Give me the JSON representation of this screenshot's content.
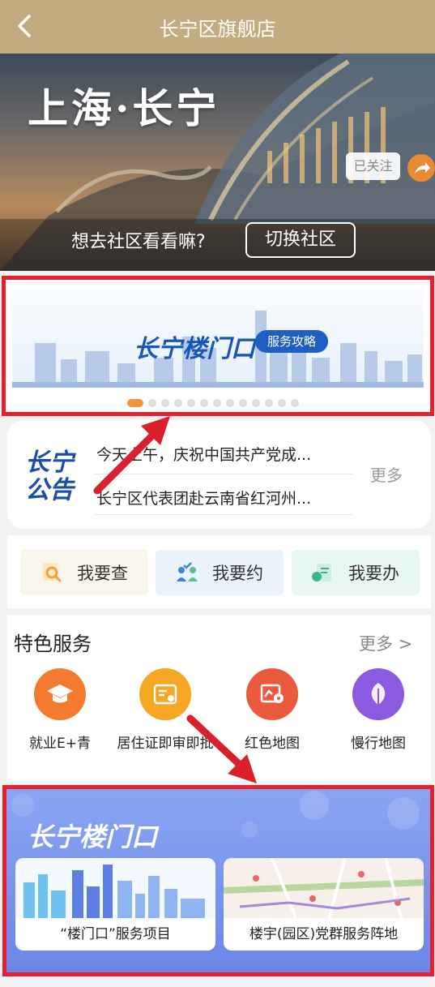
{
  "topbar": {
    "title": "长宁区旗舰店"
  },
  "hero": {
    "city_title": "上海·长宁",
    "followed_label": "已关注",
    "question": "想去社区看看嘛?",
    "switch_label": "切换社区"
  },
  "banner": {
    "logo_text": "长宁楼门口",
    "tag": "服务攻略",
    "page_count": 13,
    "active_page": 1
  },
  "notice": {
    "badge": "长宁公告",
    "items": [
      "今天上午，庆祝中国共产党成...",
      "长宁区代表团赴云南省红河州..."
    ],
    "more": "更多"
  },
  "quick_actions": [
    {
      "label": "我要查",
      "icon": "search-doc-icon",
      "bg": "#fbf6ec",
      "accent": "#f3a23a"
    },
    {
      "label": "我要约",
      "icon": "appointment-icon",
      "bg": "#eaf2fc",
      "accent": "#3d84d8"
    },
    {
      "label": "我要办",
      "icon": "handle-icon",
      "bg": "#e9f7f2",
      "accent": "#3cb58a"
    }
  ],
  "services": {
    "heading": "特色服务",
    "more": "更多 >",
    "items": [
      {
        "label": "就业E+青",
        "icon": "graduation-cap-icon",
        "color": "#f37a2e"
      },
      {
        "label": "居住证即审即批",
        "icon": "id-card-icon",
        "color": "#f5a623"
      },
      {
        "label": "红色地图",
        "icon": "red-map-icon",
        "color": "#ea5a3c"
      },
      {
        "label": "慢行地图",
        "icon": "leaf-icon",
        "color": "#8a5be0"
      }
    ]
  },
  "bottom": {
    "logo_text": "长宁楼门口",
    "cards": [
      {
        "caption": "“楼门口”服务项目"
      },
      {
        "caption": "楼宇(园区)党群服务阵地"
      }
    ]
  },
  "colors": {
    "header": "#c2ab7f",
    "highlight": "#e5202e",
    "brand_blue": "#1756b8"
  }
}
